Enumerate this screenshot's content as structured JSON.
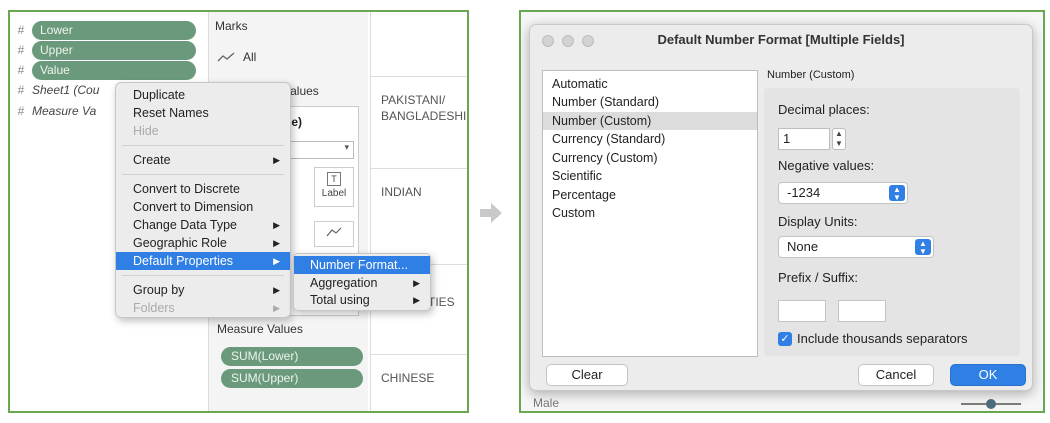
{
  "fields": {
    "items": [
      {
        "label": "Lower"
      },
      {
        "label": "Upper"
      },
      {
        "label": "Value"
      },
      {
        "label": "Sheet1 (Cou"
      },
      {
        "label": "Measure Va"
      }
    ]
  },
  "marks": {
    "title": "Marks",
    "all_label": "All",
    "measure_values_header": "re Values",
    "card_value": "alue)",
    "label_button": "Label",
    "size_fragment": "ze",
    "measure_values_title": "Measure Values",
    "pills": [
      "SUM(Lower)",
      "SUM(Upper)"
    ]
  },
  "categories": [
    "PAKISTANI/\nBANGLADESHI",
    "INDIAN",
    "ETHNICITIES",
    "CHINESE"
  ],
  "context_menu": {
    "items": [
      {
        "label": "Duplicate",
        "disabled": false
      },
      {
        "label": "Reset Names",
        "disabled": false
      },
      {
        "label": "Hide",
        "disabled": true
      },
      {
        "label": "Create",
        "disabled": false
      },
      {
        "label": "Convert to Discrete",
        "disabled": false
      },
      {
        "label": "Convert to Dimension",
        "disabled": false
      },
      {
        "label": "Change Data Type",
        "disabled": false
      },
      {
        "label": "Geographic Role",
        "disabled": false
      },
      {
        "label": "Default Properties",
        "disabled": false
      },
      {
        "label": "Group by",
        "disabled": false
      },
      {
        "label": "Folders",
        "disabled": true
      }
    ],
    "arrow": "▶"
  },
  "submenu": {
    "items": [
      "Number Format...",
      "Aggregation",
      "Total using"
    ]
  },
  "dialog": {
    "title": "Default Number Format [Multiple Fields]",
    "formats": [
      "Automatic",
      "Number (Standard)",
      "Number (Custom)",
      "Currency (Standard)",
      "Currency (Custom)",
      "Scientific",
      "Percentage",
      "Custom"
    ],
    "selected_format": "Number (Custom)",
    "section_title": "Number (Custom)",
    "decimal_label": "Decimal places:",
    "decimal_value": "1",
    "negative_label": "Negative values:",
    "negative_value": "-1234",
    "units_label": "Display Units:",
    "units_value": "None",
    "prefix_label": "Prefix / Suffix:",
    "thousands_label": "Include thousands separators",
    "thousands_checked": true,
    "clear": "Clear",
    "cancel": "Cancel",
    "ok": "OK"
  },
  "background": {
    "bottom_label": "Male"
  },
  "colors": {
    "accent": "#2f7fe5",
    "pill": "#6a9a7b",
    "frame": "#6aa84f"
  }
}
